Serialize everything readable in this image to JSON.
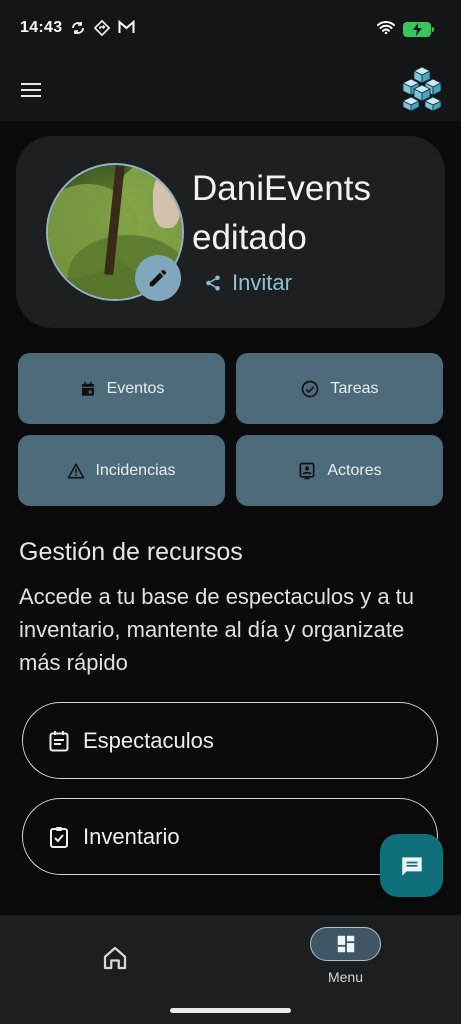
{
  "status_bar": {
    "time": "14:43",
    "icons": [
      "sync-icon",
      "navigation-icon",
      "gmail-icon"
    ],
    "right_icons": [
      "wifi-icon",
      "battery-charging-icon"
    ]
  },
  "app_bar": {
    "menu_icon": "hamburger-icon",
    "logo_icon": "cube-logo-icon"
  },
  "profile": {
    "name": "DaniEvents editado",
    "edit_icon": "pencil-icon",
    "invite_label": "Invitar",
    "invite_icon": "share-icon"
  },
  "quick_actions": [
    {
      "label": "Eventos",
      "icon": "calendar-icon"
    },
    {
      "label": "Tareas",
      "icon": "check-circle-icon"
    },
    {
      "label": "Incidencias",
      "icon": "warning-icon"
    },
    {
      "label": "Actores",
      "icon": "contact-badge-icon"
    }
  ],
  "resources": {
    "title": "Gestión de recursos",
    "description": "Accede a tu base de espectaculos y a tu inventario, mantente al día y organizate más rápido",
    "buttons": [
      {
        "label": "Espectaculos",
        "icon": "event-note-icon"
      },
      {
        "label": "Inventario",
        "icon": "clipboard-check-icon"
      }
    ]
  },
  "chat_fab": {
    "icon": "chat-icon"
  },
  "bottom_nav": {
    "items": [
      {
        "label": "",
        "icon": "home-icon"
      },
      {
        "label": "Menu",
        "icon": "dashboard-icon",
        "active": true
      }
    ]
  },
  "colors": {
    "background": "#0b0b0c",
    "card": "#1e1f21",
    "action_button": "#4e6b7c",
    "accent": "#8fc0d6",
    "fab": "#0f6f7a"
  }
}
